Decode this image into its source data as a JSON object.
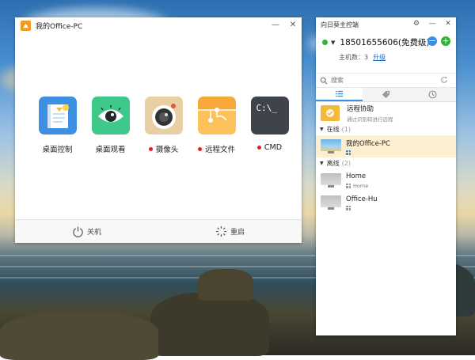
{
  "app": {
    "title": "我的Office-PC",
    "tiles": [
      {
        "label": "桌面控制",
        "icon": "desktop-control-icon",
        "dot": false
      },
      {
        "label": "桌面观看",
        "icon": "eye-icon",
        "dot": false
      },
      {
        "label": "摄像头",
        "icon": "camera-icon",
        "dot": true
      },
      {
        "label": "远程文件",
        "icon": "folder-icon",
        "dot": true
      },
      {
        "label": "CMD",
        "icon": "terminal-icon",
        "dot": true
      }
    ],
    "footer": {
      "shutdown": "关机",
      "restart": "重启"
    },
    "cmd_glyph": "C:\\_"
  },
  "panel": {
    "title": "向日葵主控端",
    "account": "18501655606(免费级)",
    "host_count_label": "主机数：3",
    "upgrade_label": "升级",
    "search_placeholder": "搜索",
    "remote_assist": {
      "title": "远程协助",
      "subtitle": "通过识别码进行远程"
    },
    "online_group": {
      "label": "在线",
      "count": "(1)"
    },
    "offline_group": {
      "label": "离线",
      "count": "(2)"
    },
    "devices": [
      {
        "name": "我的Office-PC",
        "sub": "",
        "online": true
      },
      {
        "name": "Home",
        "sub": "Home",
        "online": false
      },
      {
        "name": "Office-Hu",
        "sub": "",
        "online": false
      }
    ]
  },
  "colors": {
    "accent": "#3a8ee6",
    "online": "#2fb23b",
    "tile_blue": "#3d8fe4",
    "tile_green": "#3ec88a",
    "tile_beige": "#e9cfa3",
    "tile_orange": "#f7a93b",
    "tile_dark": "#3e434c",
    "warn_red": "#e0221b"
  }
}
